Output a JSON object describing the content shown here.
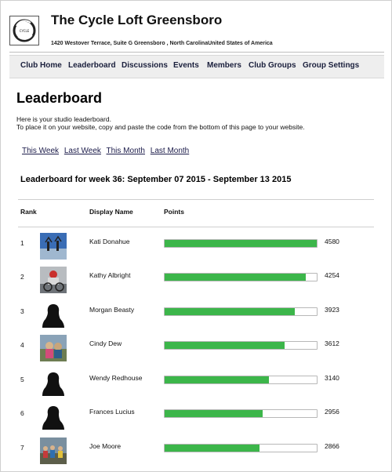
{
  "club": {
    "name": "The Cycle Loft Greensboro",
    "address": "1420 Westover Terrace, Suite G Greensboro , North CarolinaUnited States of America",
    "logo_icon": "cycle-loft-logo"
  },
  "nav": {
    "items": [
      "Club Home",
      "Leaderboard",
      "Discussions",
      "Events",
      "Members",
      "Club Groups",
      "Group Settings"
    ]
  },
  "page": {
    "title": "Leaderboard",
    "intro_line1": "Here is your studio leaderboard.",
    "intro_line2": "To place it on your website, copy and paste the code from the bottom of this page to your website."
  },
  "periods": [
    "This Week",
    "Last Week",
    "This Month",
    "Last Month"
  ],
  "board": {
    "heading": "Leaderboard for week 36: September 07 2015 - September 13 2015",
    "columns": {
      "rank": "Rank",
      "name": "Display Name",
      "points": "Points"
    },
    "max_points": 4580,
    "bar_color": "#3cb64a",
    "rows": [
      {
        "rank": "1",
        "name": "Kati Donahue",
        "points": "4580",
        "value": 4580,
        "avatar": "photo-sky"
      },
      {
        "rank": "2",
        "name": "Kathy Albright",
        "points": "4254",
        "value": 4254,
        "avatar": "photo-cyclist"
      },
      {
        "rank": "3",
        "name": "Morgan Beasty",
        "points": "3923",
        "value": 3923,
        "avatar": "silhouette"
      },
      {
        "rank": "4",
        "name": "Cindy Dew",
        "points": "3612",
        "value": 3612,
        "avatar": "photo-outdoor"
      },
      {
        "rank": "5",
        "name": "Wendy Redhouse",
        "points": "3140",
        "value": 3140,
        "avatar": "silhouette"
      },
      {
        "rank": "6",
        "name": "Frances Lucius",
        "points": "2956",
        "value": 2956,
        "avatar": "silhouette"
      },
      {
        "rank": "7",
        "name": "Joe Moore",
        "points": "2866",
        "value": 2866,
        "avatar": "photo-group"
      }
    ]
  }
}
